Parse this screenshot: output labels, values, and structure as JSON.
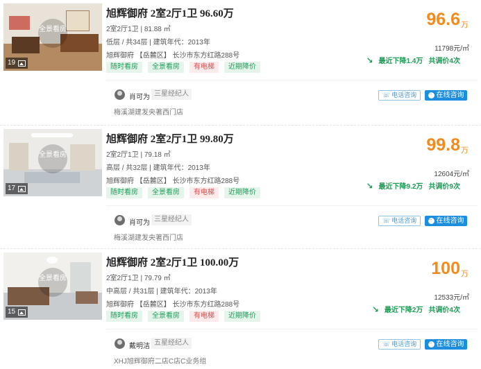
{
  "listings": [
    {
      "title": "旭辉御府 2室2厅1卫 96.60万",
      "layout_area": "2室2厅1卫 | 81.88 ㎡",
      "floor_year": "低层 / 共34层 | 建筑年代：2013年",
      "address": "旭辉御府 【岳麓区】 长沙市东方红路288号",
      "photo_count": "19",
      "vr_label": "全景看房",
      "tags": [
        "随时看房",
        "全景看房",
        "有电梯",
        "近期降价"
      ],
      "price": "96.6",
      "price_unit": "万",
      "unit_price": "11798元/㎡",
      "drop_text": "最近下降1.4万",
      "adjust_text": "共调价4次",
      "agent_name": "肖可为",
      "agent_level": "三星经纪人",
      "agent_store": "梅溪湖建发央著西门店",
      "phone_btn": "电话咨询",
      "online_btn": "在线咨询"
    },
    {
      "title": "旭辉御府 2室2厅1卫 99.80万",
      "layout_area": "2室2厅1卫 | 79.18 ㎡",
      "floor_year": "高层 / 共32层 | 建筑年代：2013年",
      "address": "旭辉御府 【岳麓区】 长沙市东方红路288号",
      "photo_count": "17",
      "vr_label": "全景看房",
      "tags": [
        "随时看房",
        "全景看房",
        "有电梯",
        "近期降价"
      ],
      "price": "99.8",
      "price_unit": "万",
      "unit_price": "12604元/㎡",
      "drop_text": "最近下降9.2万",
      "adjust_text": "共调价9次",
      "agent_name": "肖可为",
      "agent_level": "三星经纪人",
      "agent_store": "梅溪湖建发央著西门店",
      "phone_btn": "电话咨询",
      "online_btn": "在线咨询"
    },
    {
      "title": "旭辉御府 2室2厅1卫 100.00万",
      "layout_area": "2室2厅1卫 | 79.79 ㎡",
      "floor_year": "中高层 / 共31层 | 建筑年代：2013年",
      "address": "旭辉御府 【岳麓区】 长沙市东方红路288号",
      "photo_count": "15",
      "vr_label": "全景看房",
      "tags": [
        "随时看房",
        "全景看房",
        "有电梯",
        "近期降价"
      ],
      "price": "100",
      "price_unit": "万",
      "unit_price": "12533元/㎡",
      "drop_text": "最近下降2万",
      "adjust_text": "共调价4次",
      "agent_name": "戴明洁",
      "agent_level": "五星经纪人",
      "agent_store": "XHJ旭辉御府二店C店C业务组",
      "phone_btn": "电话咨询",
      "online_btn": "在线咨询"
    }
  ],
  "colors": {
    "price": "#f28b1e",
    "green_tag_bg": "#e5f5ec",
    "green_tag_text": "#1e9c57",
    "red_tag_bg": "#fdeaea",
    "red_tag_text": "#e04b4b",
    "online_btn": "#1b8ee0"
  },
  "icons": [
    "picture-icon",
    "trend-down-icon",
    "phone-icon",
    "chat-icon"
  ]
}
